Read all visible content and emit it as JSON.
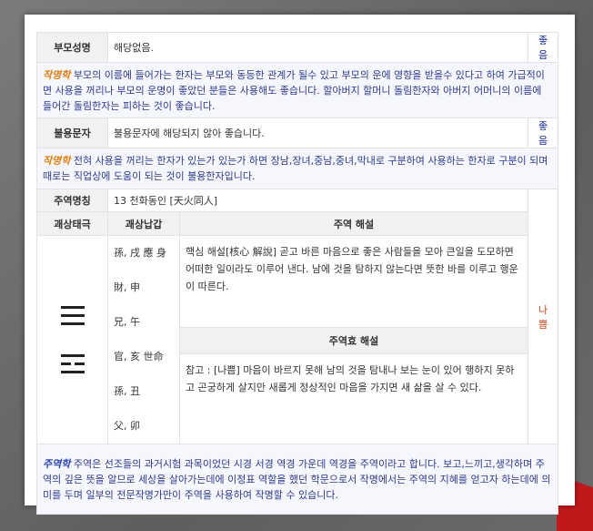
{
  "rows": {
    "parent_name": {
      "label": "부모성명",
      "value": "해당없음.",
      "verdict": "좋음",
      "tag": "작명학",
      "note": "부모의 이름에 들어가는 한자는 부모와 동등한 관계가 될수 있고 부모의 운에 영향을 받을수 있다고 하여 가급적이면 사용을 꺼리나 부모의 운명이 좋았던 분들은 사용해도 좋습니다. 할아버지 할머니 돌림한자와 아버지 어머니의 이름에 들어간 돌림한자는 피하는 것이 좋습니다."
    },
    "inauspicious": {
      "label": "불용문자",
      "value": "불용문자에 해당되지 않아 좋습니다.",
      "verdict": "좋음",
      "tag": "작명학",
      "note": "전혀 사용을 꺼리는 한자가 있는가 있는가 하면 장남,장녀,중남,중녀,막내로 구분하여 사용하는 한자로 구분이 되며 때로는 직업상에 도움이 되는 것이 불용한자입니다."
    },
    "iching": {
      "label": "주역명칭",
      "value": "13 천화동인 [天火同人]",
      "verdict": "나쁨",
      "col_hexagram": "괘상태극",
      "col_lines": "괘상납갑",
      "col_interp": "주역 해설",
      "lines": [
        "孫, 戌 應 身",
        "財, 申",
        "兄, 午",
        "官, 亥 世命",
        "孫, 丑",
        "父, 卯"
      ],
      "hexagram": [
        "yang",
        "yang",
        "yang",
        "yang",
        "yin",
        "yang"
      ],
      "interp": "핵심 해설[核心 解說] 곧고 바른 마음으로 좋은 사람들을 모아 큰일을 도모하면 어떠한 일이라도 이루어 낸다. 남에 것을 탐하지 않는다면 뜻한 바를 이루고 행운이 따른다.",
      "effect_title": "주역효 해설",
      "effect": "참고 : [나쁨] 마음이 바르지 못해 남의 것을 탐내나 보는 눈이 있어 행하지 못하고 곤궁하게 살지만 새롭게 정상적인 마음을 가지면 새 삶을 살 수 있다."
    },
    "footer": {
      "tag": "주역학",
      "note": "주역은 선조들의 과거시험 과목이었던 시경 서경 역경 가운데 역경을 주역이라고 합니다. 보고,느끼고,생각하며 주역의 깊은 뜻을 알므로 세상을 살아가는데에 이정표 역할을 했던 학문으로서 작명에서는 주역의 지혜를 얻고자 하는데에 의미를 두며 일부의 전문작명가만이 주역을 사용하여 작명할 수 있습니다."
    }
  },
  "colors": {
    "good": "#1d2a94",
    "bad": "#c8421b",
    "tag_orange": "#e07d13",
    "tag_blue": "#2b44b3"
  }
}
